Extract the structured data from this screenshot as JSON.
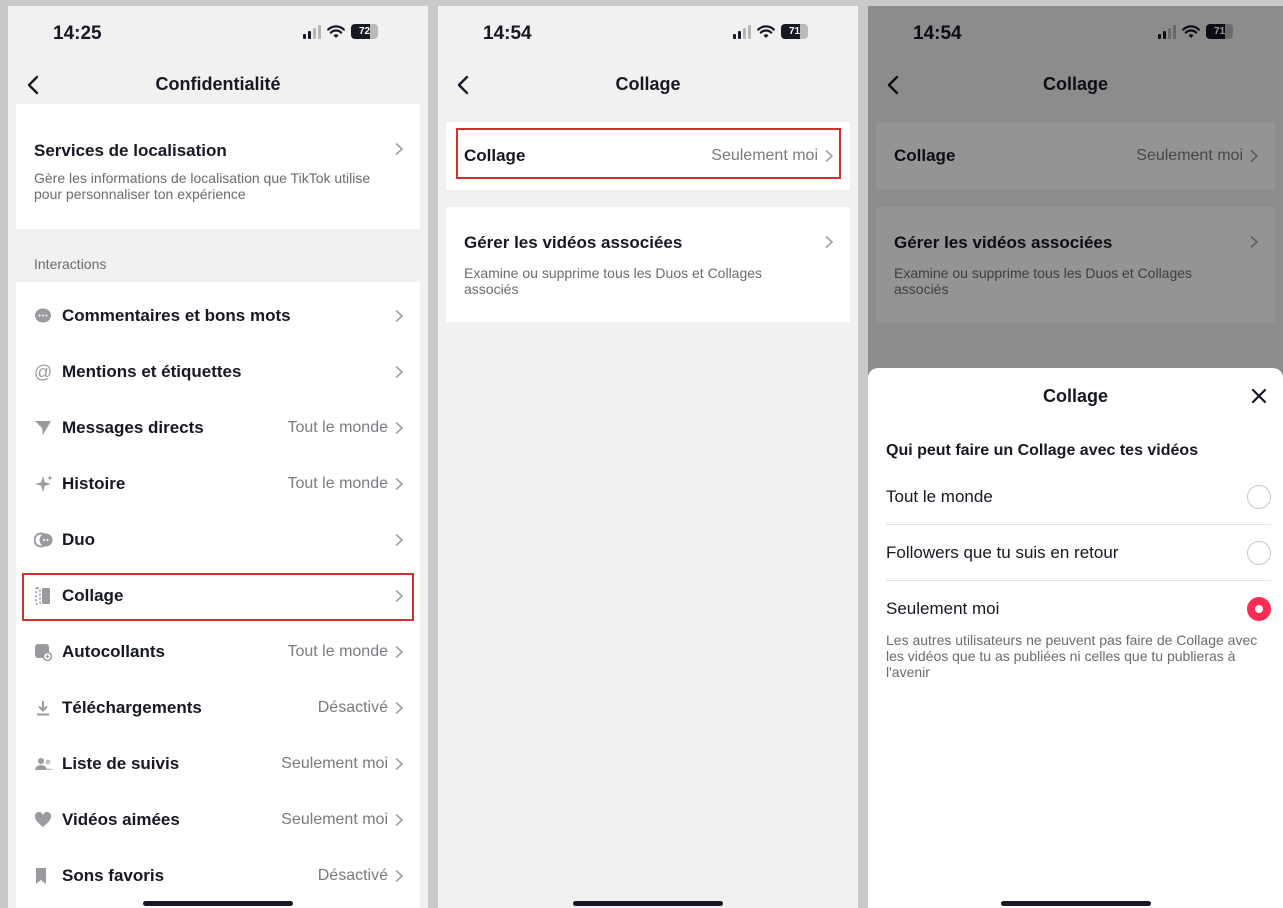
{
  "colors": {
    "accent": "#fe2c55",
    "highlight": "#d0312d",
    "text": "#161823",
    "muted": "#7a7a80",
    "background": "#f1f1f2"
  },
  "screen1": {
    "time": "14:25",
    "battery": "72",
    "title": "Confidentialité",
    "location": {
      "label": "Services de localisation",
      "desc": "Gère les informations de localisation que TikTok utilise pour personnaliser ton expérience"
    },
    "section_interactions": "Interactions",
    "items": [
      {
        "icon": "comment-icon",
        "label": "Commentaires et bons mots",
        "value": ""
      },
      {
        "icon": "at-icon",
        "label": "Mentions et étiquettes",
        "value": ""
      },
      {
        "icon": "send-icon",
        "label": "Messages directs",
        "value": "Tout le monde"
      },
      {
        "icon": "sparkle-icon",
        "label": "Histoire",
        "value": "Tout le monde"
      },
      {
        "icon": "duet-icon",
        "label": "Duo",
        "value": ""
      },
      {
        "icon": "stitch-icon",
        "label": "Collage",
        "value": ""
      },
      {
        "icon": "sticker-icon",
        "label": "Autocollants",
        "value": "Tout le monde"
      },
      {
        "icon": "download-icon",
        "label": "Téléchargements",
        "value": "Désactivé"
      },
      {
        "icon": "people-icon",
        "label": "Liste de suivis",
        "value": "Seulement moi"
      },
      {
        "icon": "heart-icon",
        "label": "Vidéos aimées",
        "value": "Seulement moi"
      },
      {
        "icon": "bookmark-icon",
        "label": "Sons favoris",
        "value": "Désactivé"
      }
    ]
  },
  "screen2": {
    "time": "14:54",
    "battery": "71",
    "title": "Collage",
    "collage_row": {
      "label": "Collage",
      "value": "Seulement moi"
    },
    "manage": {
      "label": "Gérer les vidéos associées",
      "desc": "Examine ou supprime tous les Duos et Collages associés"
    }
  },
  "screen3": {
    "time": "14:54",
    "battery": "71",
    "title": "Collage",
    "collage_row": {
      "label": "Collage",
      "value": "Seulement moi"
    },
    "manage": {
      "label": "Gérer les vidéos associées",
      "desc": "Examine ou supprime tous les Duos et Collages associés"
    },
    "sheet": {
      "title": "Collage",
      "question": "Qui peut faire un Collage avec tes vidéos",
      "options": [
        {
          "label": "Tout le monde",
          "selected": false
        },
        {
          "label": "Followers que tu suis en retour",
          "selected": false
        },
        {
          "label": "Seulement moi",
          "selected": true
        }
      ],
      "note": "Les autres utilisateurs ne peuvent pas faire de Collage avec les vidéos que tu as publiées ni celles que tu publieras à l'avenir"
    }
  }
}
